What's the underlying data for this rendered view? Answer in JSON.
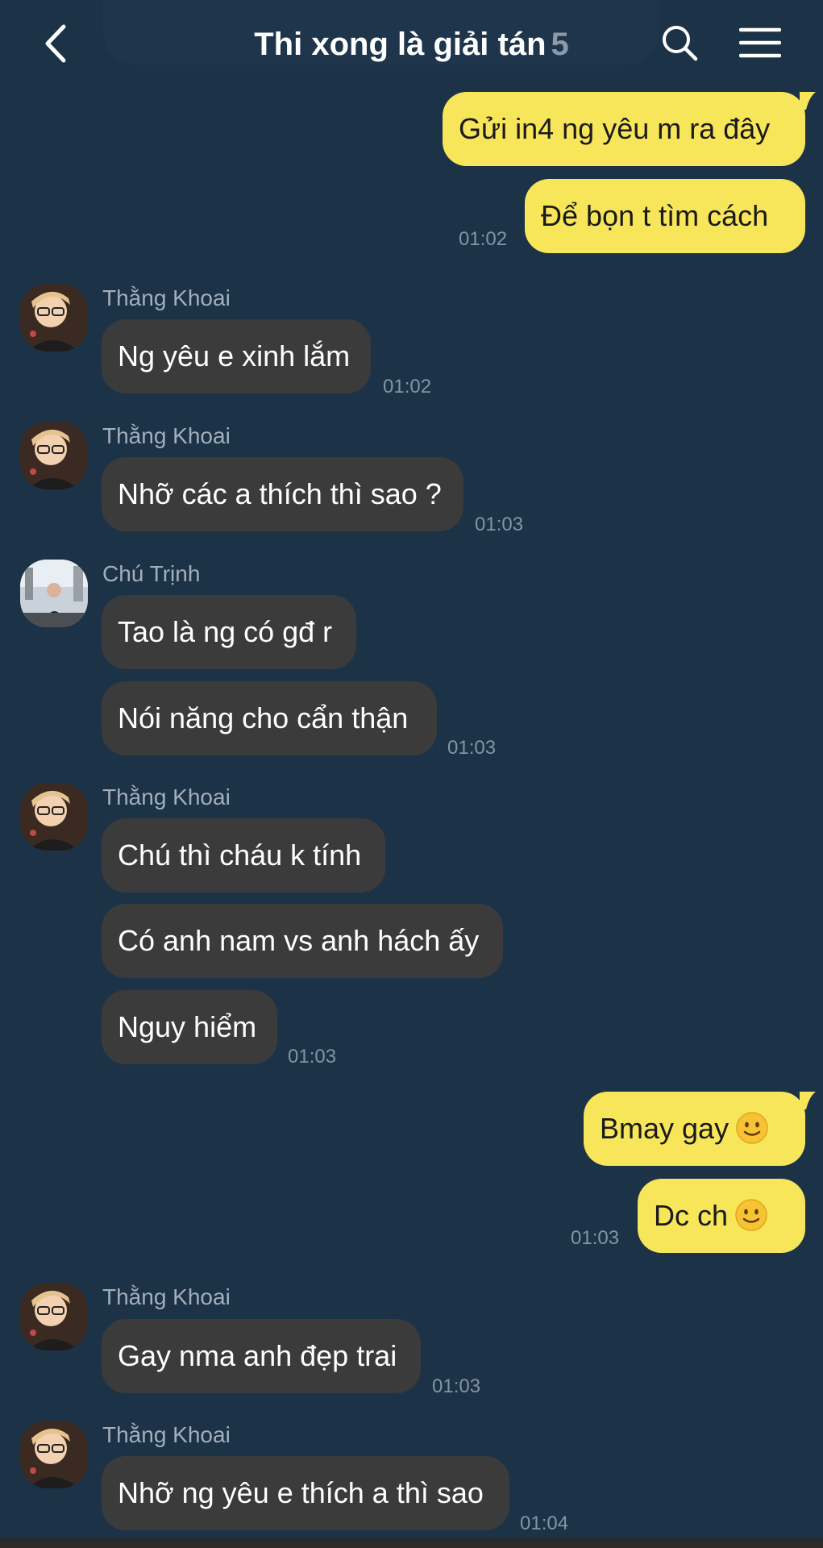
{
  "header": {
    "title": "Thi xong là giải tán",
    "member_count": "5",
    "back_icon": "chevron-left-icon",
    "search_icon": "search-icon",
    "menu_icon": "hamburger-menu-icon"
  },
  "colors": {
    "background": "#1c3247",
    "incoming_bubble": "#3b3b3c",
    "outgoing_bubble": "#f8e65a",
    "timestamp": "#8394a5",
    "sender_name": "#a3afbb"
  },
  "messages": [
    {
      "direction": "out",
      "text": "Gửi in4 ng yêu m ra đây"
    },
    {
      "direction": "out",
      "text": "Để bọn t tìm cách",
      "time": "01:02"
    },
    {
      "direction": "in",
      "sender": "Thằng Khoai",
      "text": "Ng yêu e xinh lắm",
      "time": "01:02"
    },
    {
      "direction": "in",
      "sender": "Thằng Khoai",
      "text": "Nhỡ các a thích thì sao ?",
      "time": "01:03"
    },
    {
      "direction": "in",
      "sender": "Chú Trịnh",
      "text": "Tao là ng có gđ r"
    },
    {
      "direction": "in",
      "text": "Nói năng cho cẩn thận",
      "time": "01:03"
    },
    {
      "direction": "in",
      "sender": "Thằng Khoai",
      "text": "Chú thì cháu k tính"
    },
    {
      "direction": "in",
      "text": "Có anh nam vs anh hách ấy"
    },
    {
      "direction": "in",
      "text": "Nguy hiểm",
      "time": "01:03"
    },
    {
      "direction": "out",
      "text": "Bmay gay",
      "emoji": "slightly-smiling-face-icon"
    },
    {
      "direction": "out",
      "text": "Dc ch",
      "emoji": "slightly-smiling-face-icon",
      "time": "01:03"
    },
    {
      "direction": "in",
      "sender": "Thằng Khoai",
      "text": "Gay nma anh đẹp trai",
      "time": "01:03"
    },
    {
      "direction": "in",
      "sender": "Thằng Khoai",
      "text": "Nhỡ ng yêu e thích a thì sao",
      "time": "01:04"
    }
  ]
}
